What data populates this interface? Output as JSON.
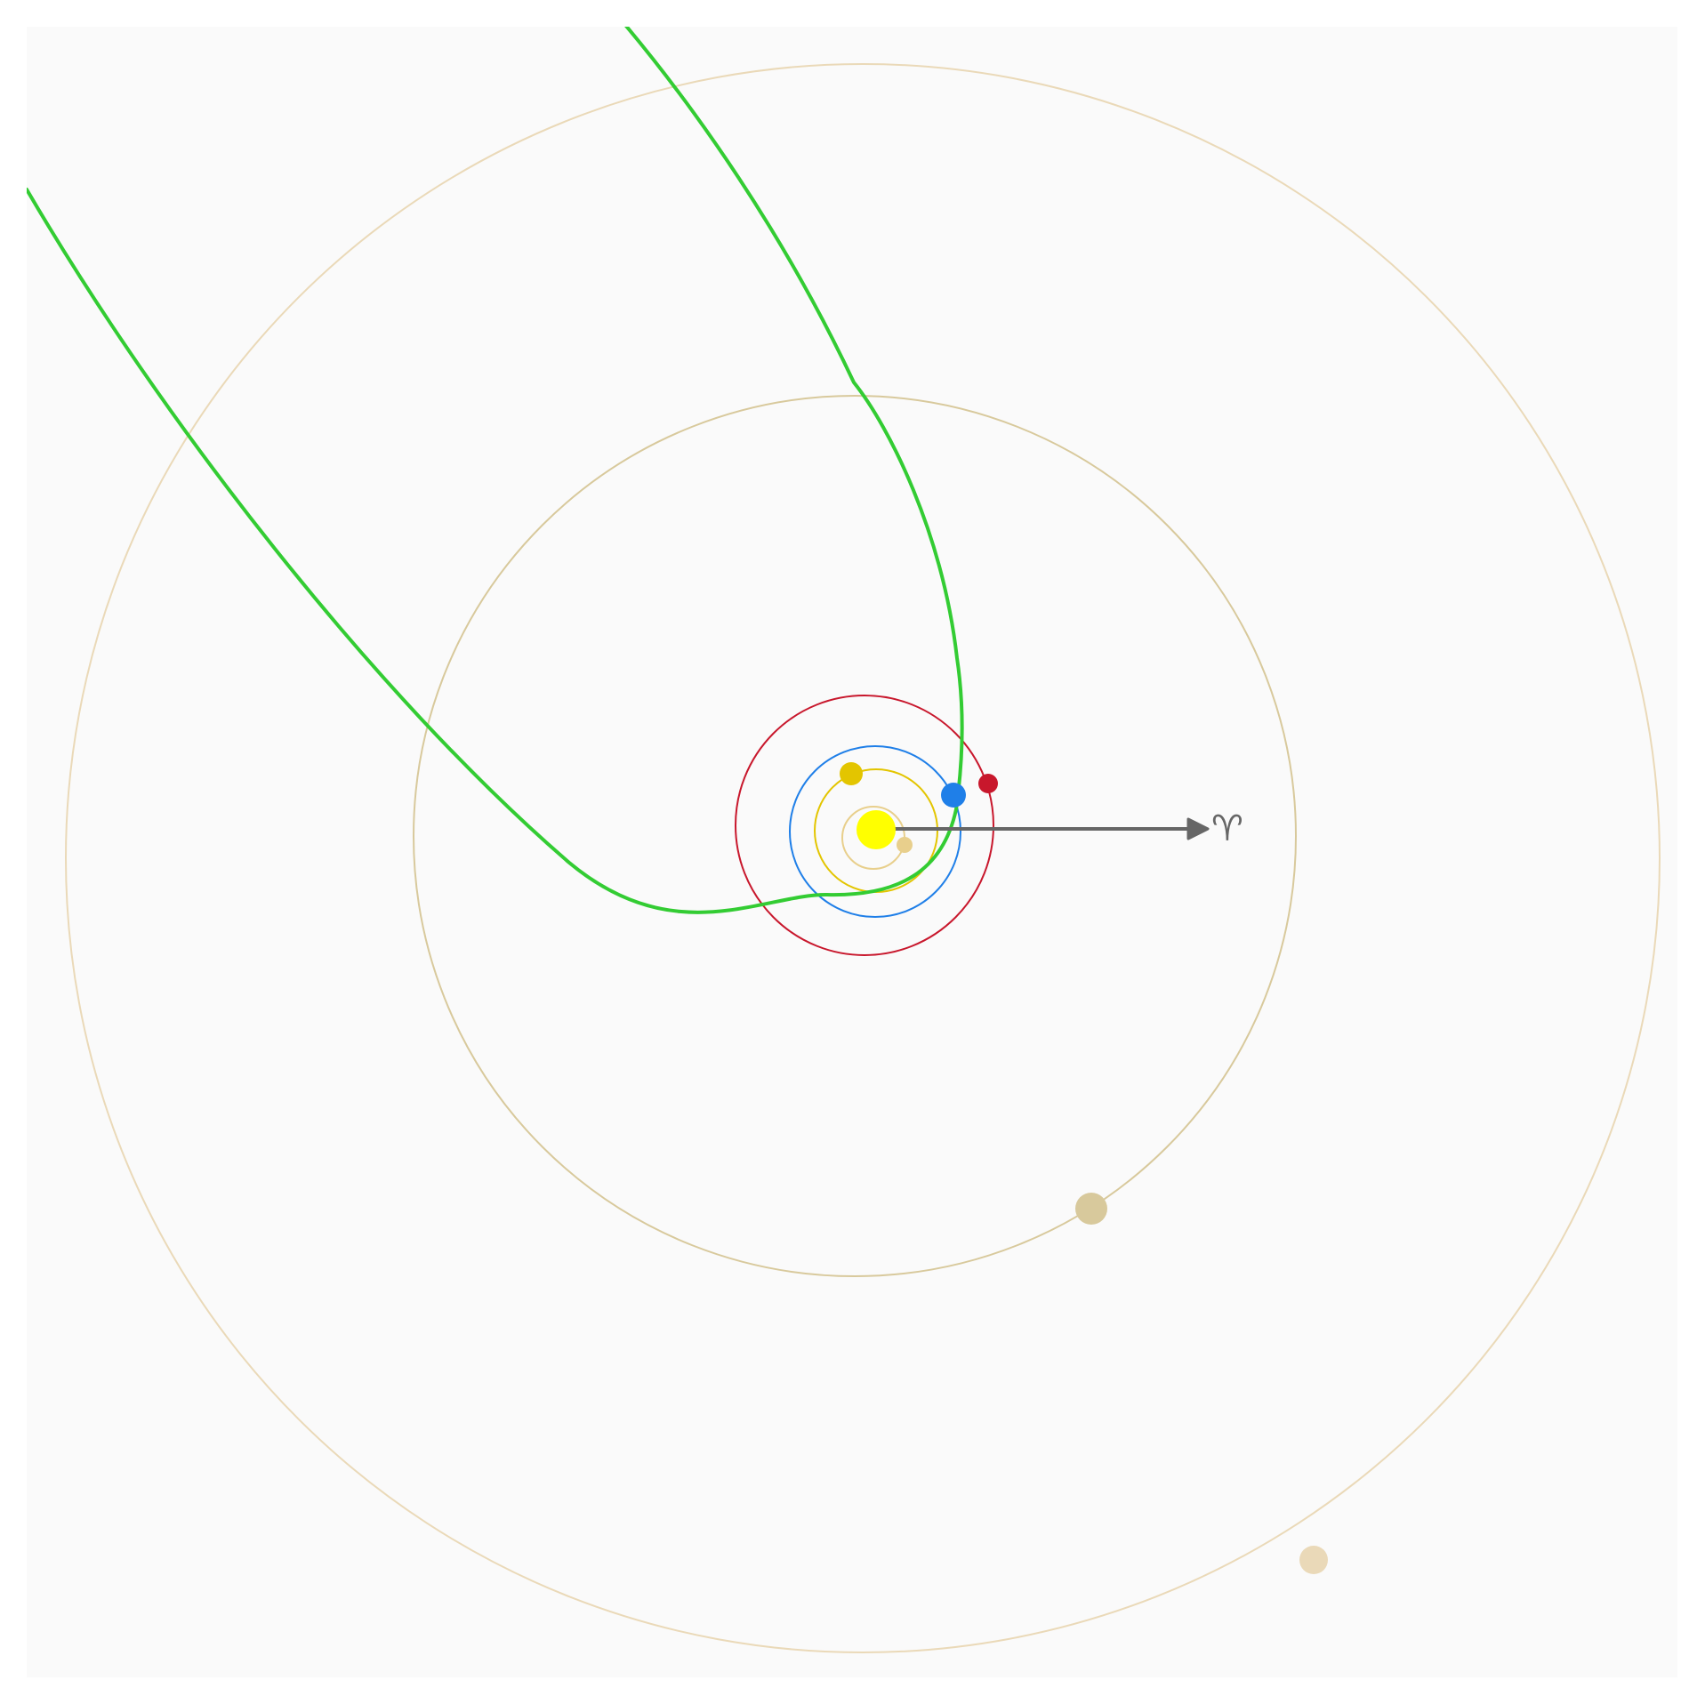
{
  "colors": {
    "page_background": "#ffffff",
    "plot_background": "#fafafa",
    "sun": "#ffff00",
    "mercury": "#e8cf8c",
    "venus": "#e3c500",
    "earth": "#1f7fe8",
    "mars": "#c8172c",
    "jupiter": "#d8c99c",
    "saturn": "#ead9b8",
    "comet_trajectory": "#33cc33",
    "vernal_equinox_arrow": "#666666"
  },
  "bodies": [
    {
      "name": "sun",
      "icon": "sun-icon"
    },
    {
      "name": "mercury",
      "icon": "planet-icon"
    },
    {
      "name": "venus",
      "icon": "planet-icon"
    },
    {
      "name": "earth",
      "icon": "planet-icon"
    },
    {
      "name": "mars",
      "icon": "planet-icon"
    },
    {
      "name": "jupiter",
      "icon": "planet-icon"
    },
    {
      "name": "saturn",
      "icon": "planet-icon"
    }
  ],
  "vernal_equinox_symbol": "♈"
}
